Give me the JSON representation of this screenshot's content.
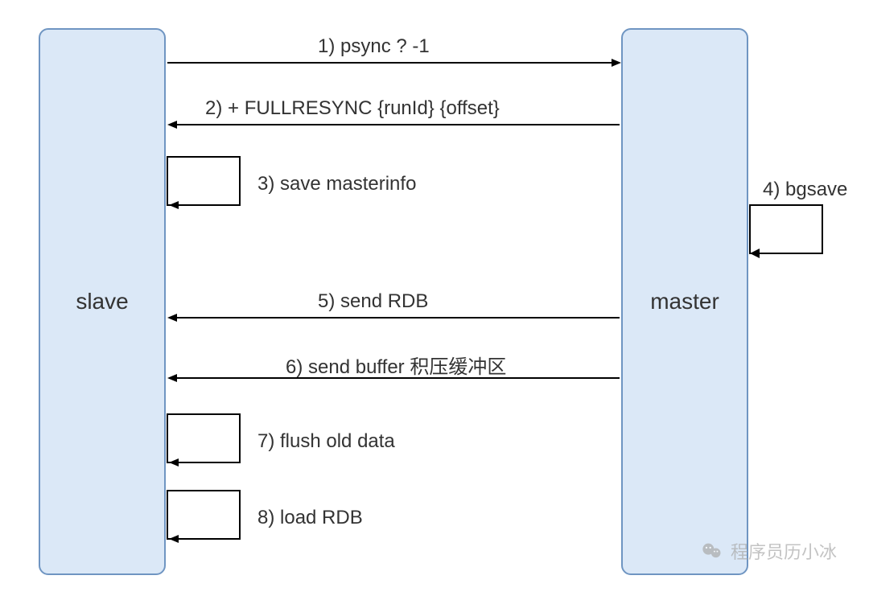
{
  "nodes": {
    "slave": "slave",
    "master": "master"
  },
  "steps": {
    "s1": "1)  psync ? -1",
    "s2": "2)  + FULLRESYNC {runId} {offset}",
    "s3": "3)  save masterinfo",
    "s4": "4)  bgsave",
    "s5": "5)  send RDB",
    "s6": "6)  send buffer 积压缓冲区",
    "s7": "7)  flush old data",
    "s8": "8)  load RDB"
  },
  "watermark": "程序员历小冰"
}
